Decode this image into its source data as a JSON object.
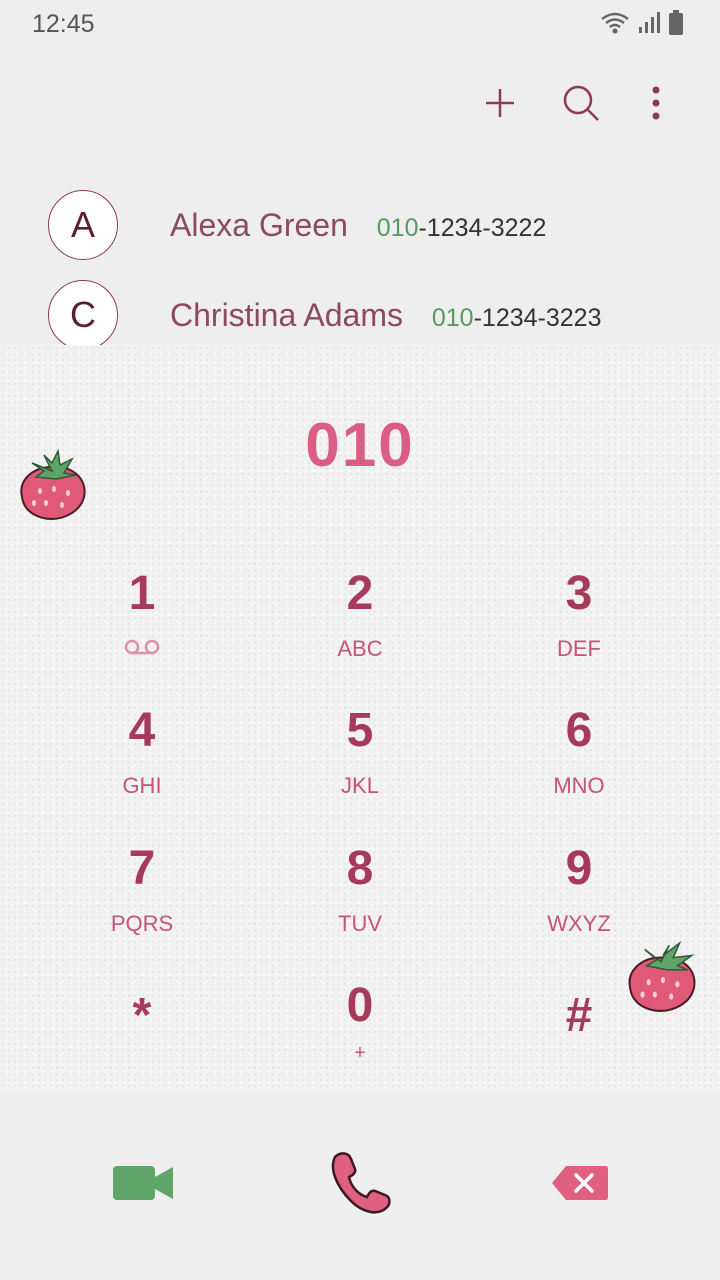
{
  "status_bar": {
    "time": "12:45",
    "icons": [
      "wifi-icon",
      "signal-icon",
      "battery-icon"
    ]
  },
  "toolbar": {
    "icons": [
      "add-icon",
      "search-icon",
      "more-vert-icon"
    ]
  },
  "contacts": [
    {
      "initial": "A",
      "name": "Alexa Green",
      "number_match": "010",
      "number_rest": "-1234-3222"
    },
    {
      "initial": "C",
      "name": "Christina Adams",
      "number_match": "010",
      "number_rest": "-1234-3223"
    }
  ],
  "dialer": {
    "input": "010",
    "keys": [
      {
        "digit": "1",
        "letters": ""
      },
      {
        "digit": "2",
        "letters": "ABC"
      },
      {
        "digit": "3",
        "letters": "DEF"
      },
      {
        "digit": "4",
        "letters": "GHI"
      },
      {
        "digit": "5",
        "letters": "JKL"
      },
      {
        "digit": "6",
        "letters": "MNO"
      },
      {
        "digit": "7",
        "letters": "PQRS"
      },
      {
        "digit": "8",
        "letters": "TUV"
      },
      {
        "digit": "9",
        "letters": "WXYZ"
      },
      {
        "digit": "*",
        "letters": ""
      },
      {
        "digit": "0",
        "letters": "+"
      },
      {
        "digit": "#",
        "letters": ""
      }
    ]
  },
  "actions": {
    "icons": [
      "video-call-icon",
      "call-icon",
      "backspace-icon"
    ]
  },
  "colors": {
    "accent": "#db5c84",
    "digit": "#a63a5c",
    "match": "#5a9a62",
    "video": "#5fa468",
    "call": "#e0607f"
  }
}
